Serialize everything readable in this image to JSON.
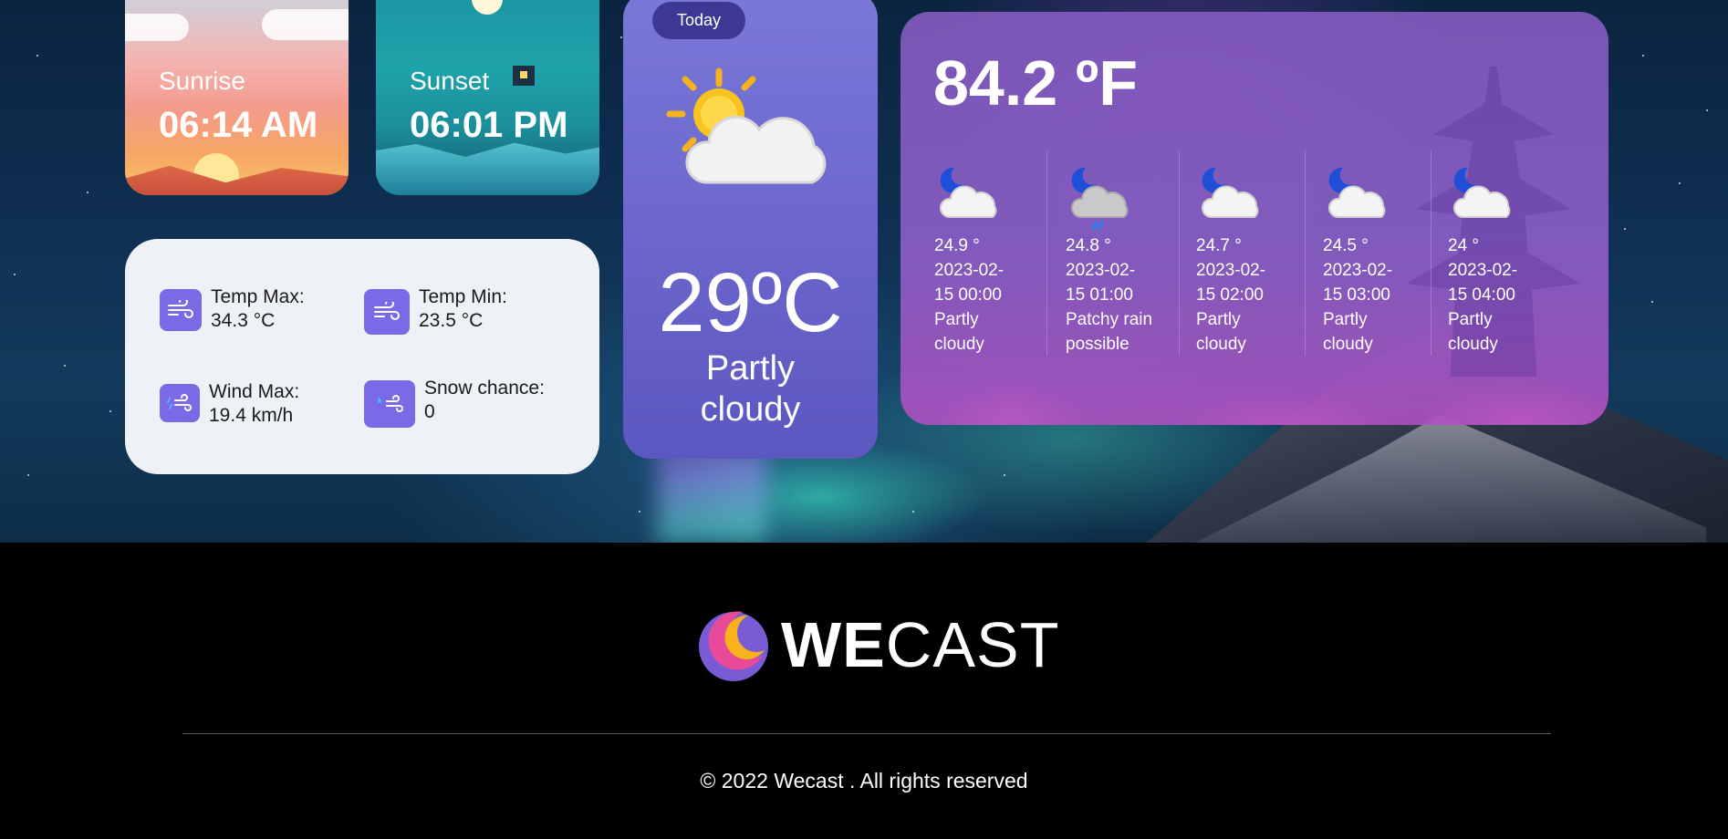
{
  "sunrise": {
    "label": "Sunrise",
    "time": "06:14 AM"
  },
  "sunset": {
    "label": "Sunset",
    "time": "06:01 PM"
  },
  "stats": {
    "temp_max_label": "Temp Max:",
    "temp_max_value": "34.3 °C",
    "temp_min_label": "Temp Min:",
    "temp_min_value": "23.5 °C",
    "wind_max_label": "Wind Max:",
    "wind_max_value": "19.4 km/h",
    "snow_label": "Snow chance:",
    "snow_value": "0"
  },
  "today": {
    "pill": "Today",
    "icon": "partly-cloudy-day-icon",
    "temp": "29ºC",
    "condition_line1": "Partly",
    "condition_line2": "cloudy"
  },
  "forecast": {
    "temp_f": "84.2 ºF",
    "hours": [
      {
        "icon": "partly-cloudy-night-icon",
        "temp": "24.9 °",
        "date": "2023-02-",
        "time": "15 00:00",
        "cond1": "Partly",
        "cond2": "cloudy"
      },
      {
        "icon": "rain-night-icon",
        "temp": "24.8 °",
        "date": "2023-02-",
        "time": "15 01:00",
        "cond1": "Patchy rain",
        "cond2": "possible"
      },
      {
        "icon": "partly-cloudy-night-icon",
        "temp": "24.7 °",
        "date": "2023-02-",
        "time": "15 02:00",
        "cond1": "Partly",
        "cond2": "cloudy"
      },
      {
        "icon": "partly-cloudy-night-icon",
        "temp": "24.5 °",
        "date": "2023-02-",
        "time": "15 03:00",
        "cond1": "Partly",
        "cond2": "cloudy"
      },
      {
        "icon": "partly-cloudy-night-icon",
        "temp": "24 °",
        "date": "2023-02-",
        "time": "15 04:00",
        "cond1": "Partly",
        "cond2": "cloudy"
      }
    ]
  },
  "footer": {
    "logo_bold": "WE",
    "logo_light": "CAST",
    "copyright": "© 2022 Wecast . All rights reserved"
  },
  "colors": {
    "accent": "#7b6ae6",
    "today_card": "#6d69cf",
    "today_pill": "#3c3994",
    "stats_bg": "#eef2f6"
  }
}
